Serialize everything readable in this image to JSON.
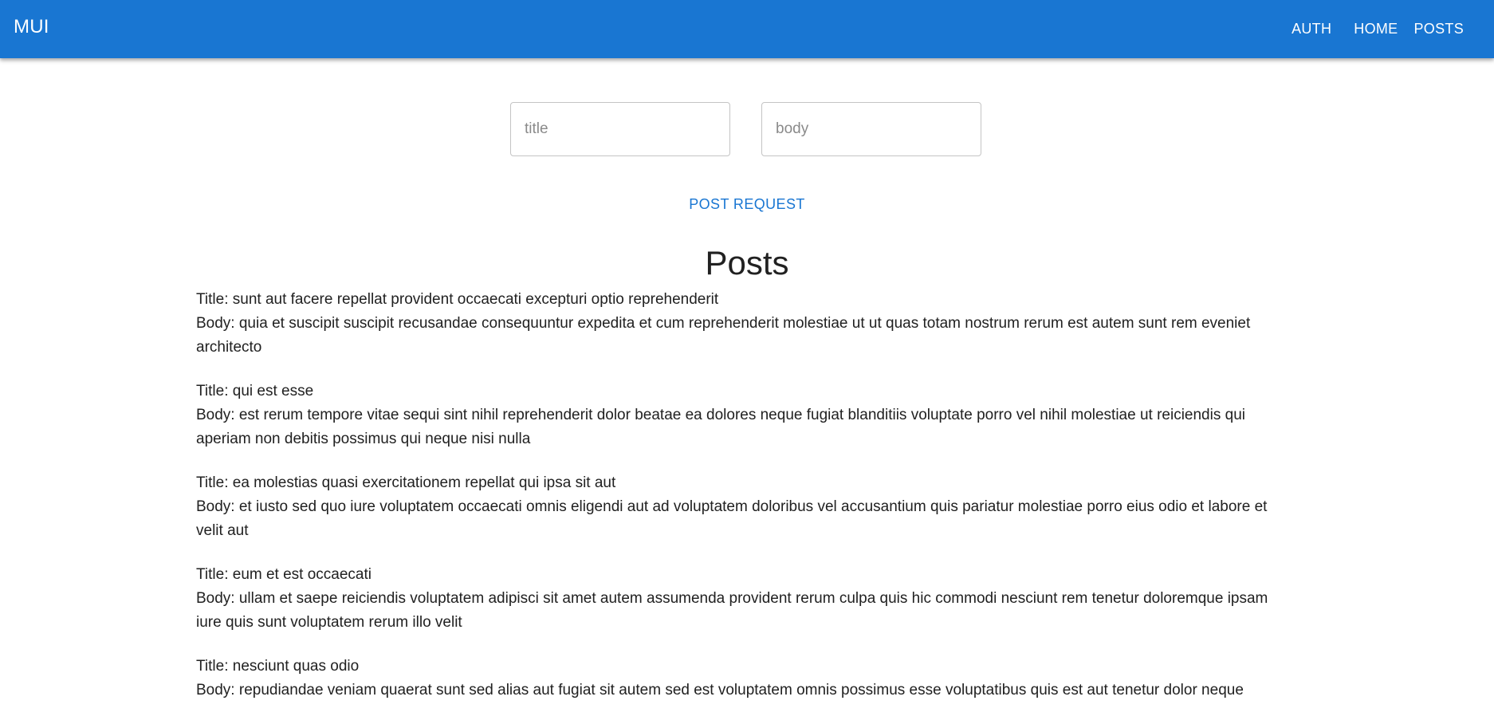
{
  "appbar": {
    "brand": "MUI",
    "nav": [
      {
        "label": "AUTH"
      },
      {
        "label": "HOME"
      },
      {
        "label": "POSTS"
      }
    ]
  },
  "form": {
    "title_placeholder": "title",
    "title_value": "",
    "body_placeholder": "body",
    "body_value": "",
    "submit_label": "POST REQUEST"
  },
  "posts": {
    "heading": "Posts",
    "items": [
      {
        "title": "Title: sunt aut facere repellat provident occaecati excepturi optio reprehenderit",
        "body": "Body: quia et suscipit suscipit recusandae consequuntur expedita et cum reprehenderit molestiae ut ut quas totam nostrum rerum est autem sunt rem eveniet architecto"
      },
      {
        "title": "Title: qui est esse",
        "body": "Body: est rerum tempore vitae sequi sint nihil reprehenderit dolor beatae ea dolores neque fugiat blanditiis voluptate porro vel nihil molestiae ut reiciendis qui aperiam non debitis possimus qui neque nisi nulla"
      },
      {
        "title": "Title: ea molestias quasi exercitationem repellat qui ipsa sit aut",
        "body": "Body: et iusto sed quo iure voluptatem occaecati omnis eligendi aut ad voluptatem doloribus vel accusantium quis pariatur molestiae porro eius odio et labore et velit aut"
      },
      {
        "title": "Title: eum et est occaecati",
        "body": "Body: ullam et saepe reiciendis voluptatem adipisci sit amet autem assumenda provident rerum culpa quis hic commodi nesciunt rem tenetur doloremque ipsam iure quis sunt voluptatem rerum illo velit"
      },
      {
        "title": "Title: nesciunt quas odio",
        "body": "Body: repudiandae veniam quaerat sunt sed alias aut fugiat sit autem sed est voluptatem omnis possimus esse voluptatibus quis est aut tenetur dolor neque"
      }
    ]
  },
  "colors": {
    "primary": "#1976d2",
    "text": "#212121",
    "border": "#c4c4c4"
  }
}
